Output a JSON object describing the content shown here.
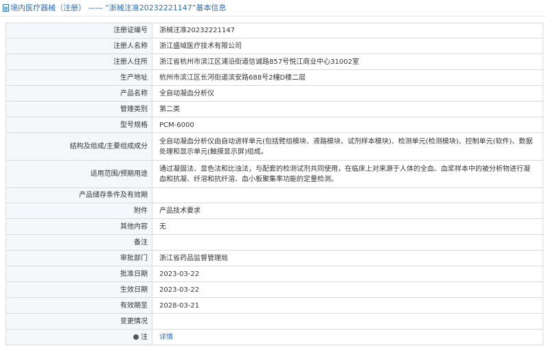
{
  "header": {
    "category": "境内医疗器械（注册）",
    "separator": "——",
    "title": "“浙械注准20232221147”基本信息"
  },
  "rows": [
    {
      "label": "注册证编号",
      "value": "浙械注准20232221147"
    },
    {
      "label": "注册人名称",
      "value": "浙江盛域医疗技术有限公司"
    },
    {
      "label": "注册人住所",
      "value": "浙江省杭州市滨江区浦沿街道信诚路857号悦江商业中心31002室"
    },
    {
      "label": "生产地址",
      "value": "杭州市滨江区长河街道滨安路688号2幢D楼二层"
    },
    {
      "label": "产品名称",
      "value": "全自动凝血分析仪"
    },
    {
      "label": "管理类别",
      "value": "第二类"
    },
    {
      "label": "型号规格",
      "value": "PCM-6000"
    },
    {
      "label": "结构及组成/主要组成成分",
      "value": "全自动凝血分析仪由自动进样单元(包括臂组模块、液路模块、试剂样本模块)、检测单元(检测模块)、控制单元(软件)、数据处理和显示单元(触摸显示屏)组成。"
    },
    {
      "label": "适用范围/预期用途",
      "value": "通过凝固法、显色法和比浊法，与配套的检测试剂共同使用，在临床上对来源于人体的全血、血浆样本中的被分析物进行凝血和抗凝、纤溶和抗纤溶、血小板聚集率功能的定量检测。"
    },
    {
      "label": "产品储存条件及有效期",
      "value": ""
    },
    {
      "label": "附件",
      "value": "产品技术要求"
    },
    {
      "label": "其他内容",
      "value": "无"
    },
    {
      "label": "备注",
      "value": ""
    },
    {
      "label": "审批部门",
      "value": "浙江省药品监督管理局"
    },
    {
      "label": "批准日期",
      "value": "2023-03-22"
    },
    {
      "label": "生效日期",
      "value": "2023-03-22"
    },
    {
      "label": "有效期至",
      "value": "2028-03-21"
    },
    {
      "label": "变更情况",
      "value": ""
    }
  ],
  "footer_row": {
    "label": "注",
    "link": "详情"
  }
}
